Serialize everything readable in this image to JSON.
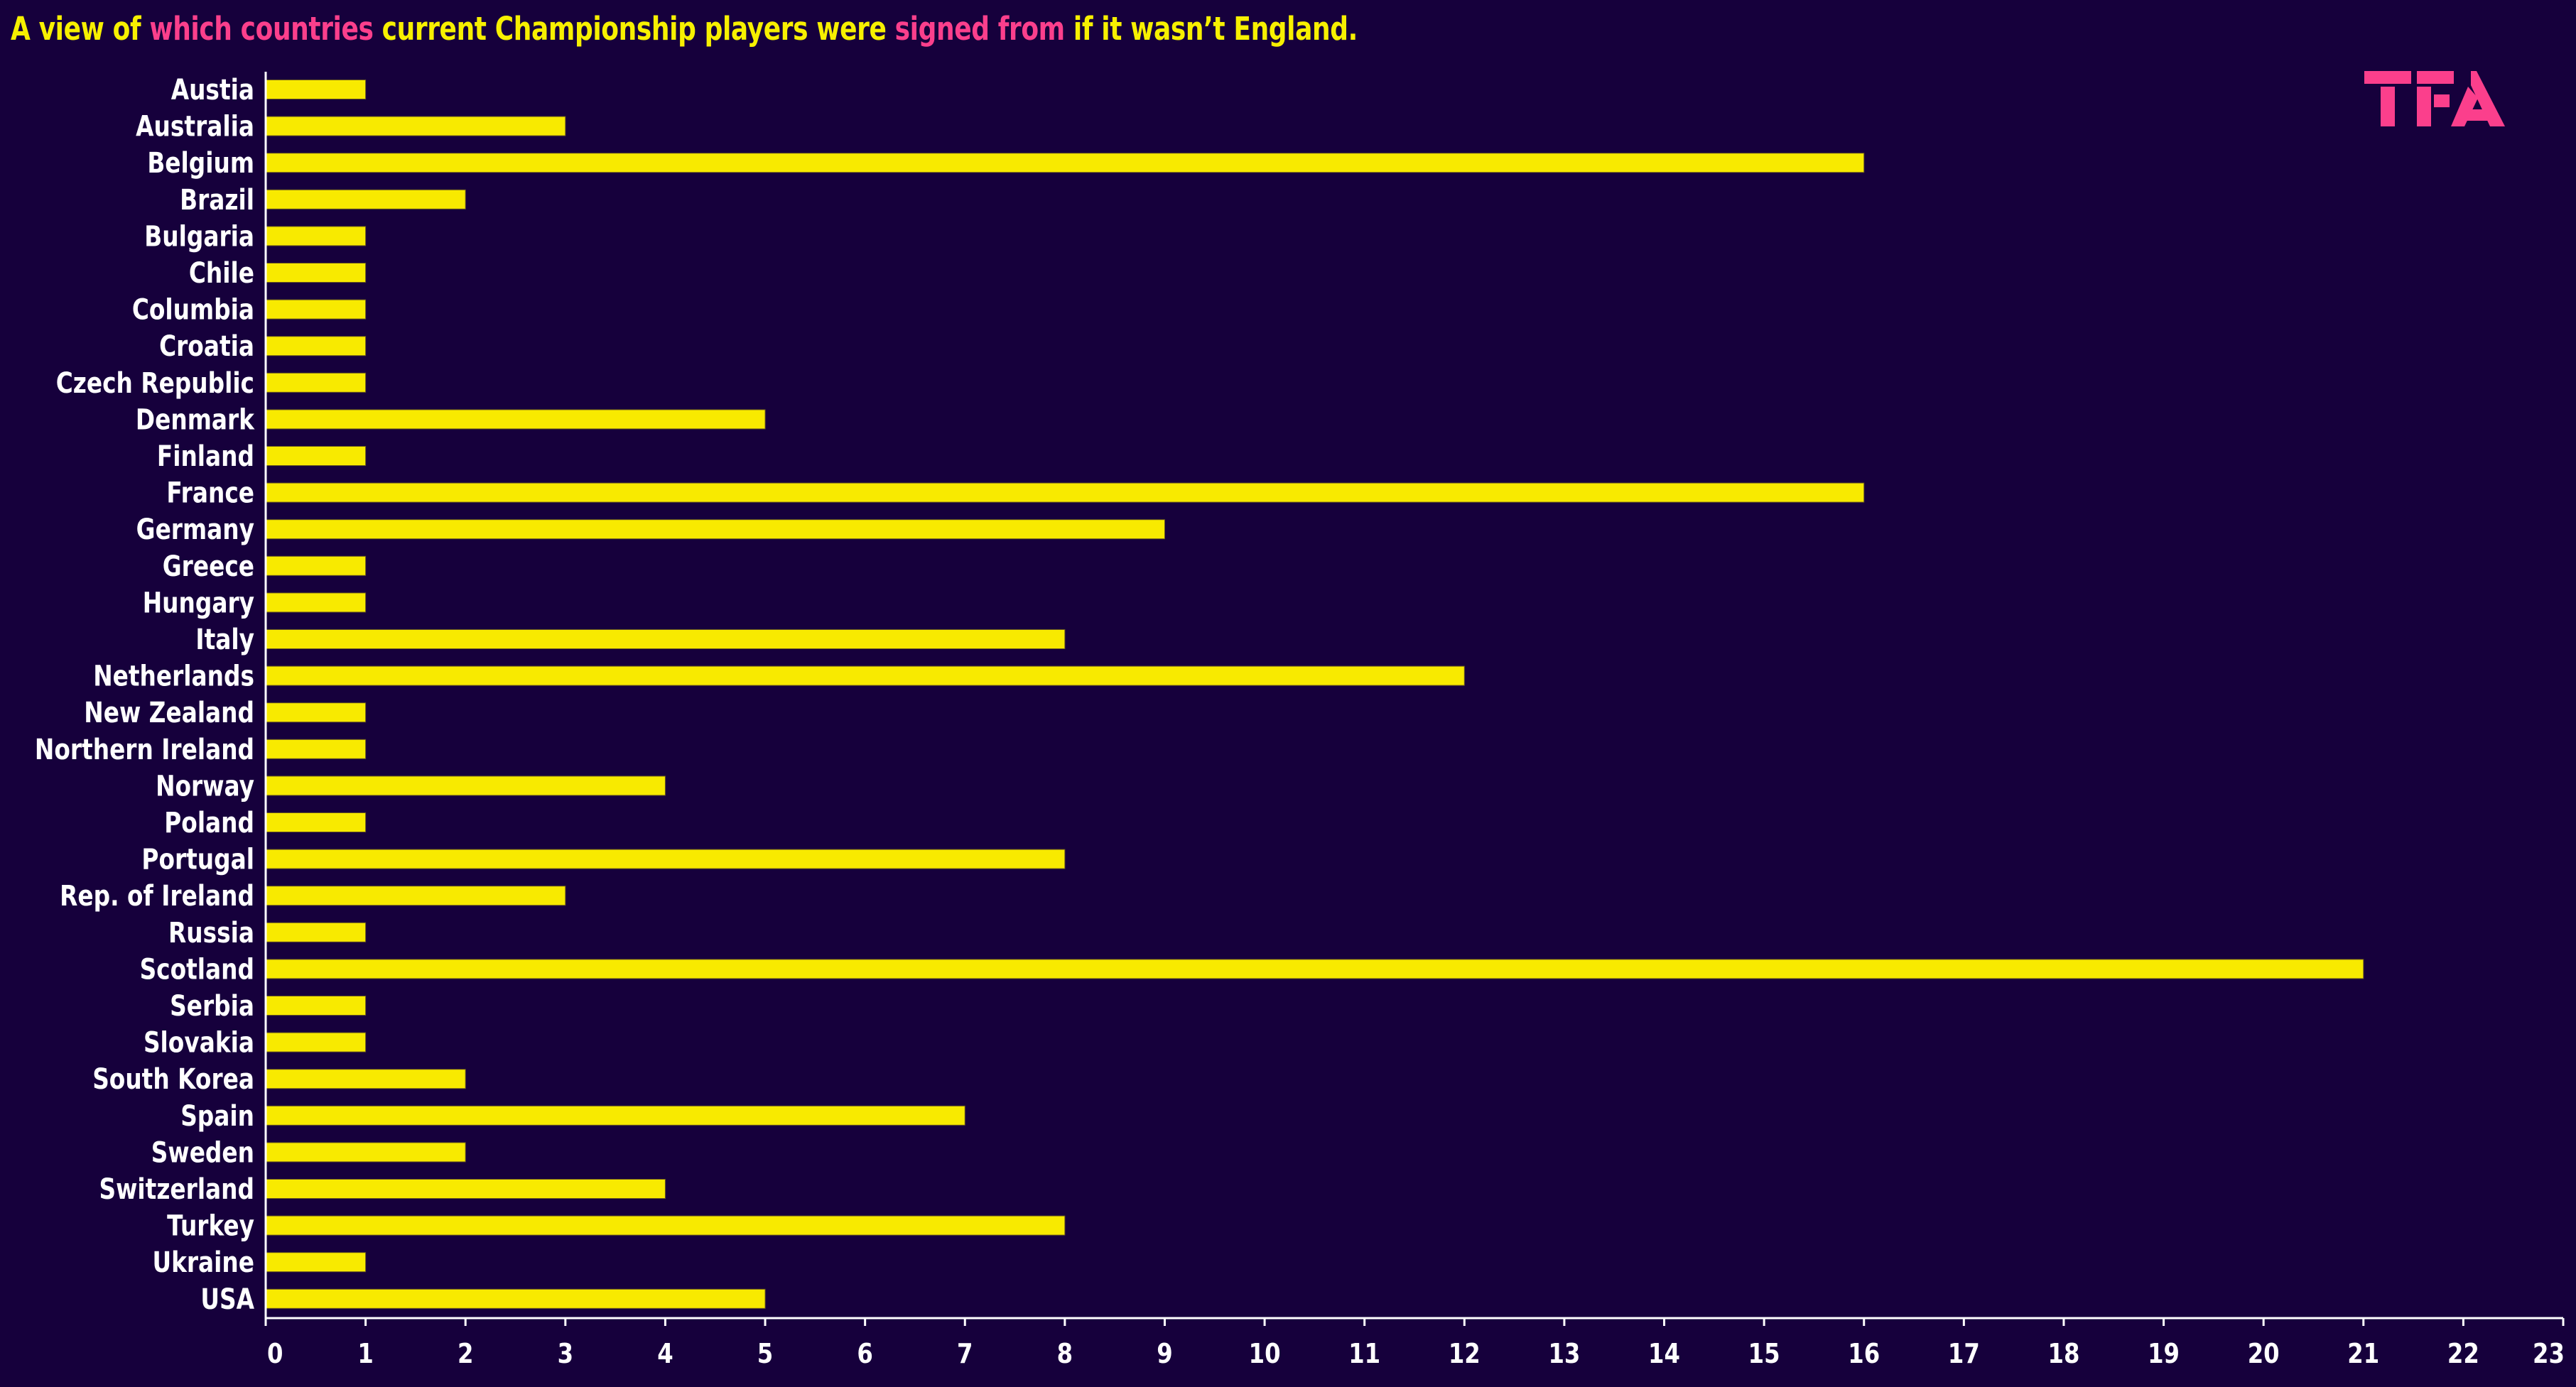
{
  "title": {
    "segments": [
      {
        "text": "A view of ",
        "color": "yellow"
      },
      {
        "text": "which countries",
        "color": "pink"
      },
      {
        "text": " current Championship players were ",
        "color": "yellow"
      },
      {
        "text": "signed from",
        "color": "pink"
      },
      {
        "text": " if it wasn’t England.",
        "color": "yellow"
      }
    ]
  },
  "logo": {
    "text": "TFA",
    "icon": "tfa-logo-icon"
  },
  "colors": {
    "background": "#16003c",
    "bar": "#f8ea00",
    "title_yellow": "#f7f000",
    "title_pink": "#fb3f8c",
    "text": "#ffffff",
    "axis": "#ffffff"
  },
  "chart_data": {
    "type": "bar",
    "orientation": "horizontal",
    "title": "A view of which countries current Championship players were signed from if it wasn’t England.",
    "xlabel": "",
    "ylabel": "",
    "xlim": [
      0,
      23
    ],
    "xticks": [
      0,
      1,
      2,
      3,
      4,
      5,
      6,
      7,
      8,
      9,
      10,
      11,
      12,
      13,
      14,
      15,
      16,
      17,
      18,
      19,
      20,
      21,
      22,
      23
    ],
    "grid": false,
    "legend": "none",
    "categories": [
      "Austia",
      "Australia",
      "Belgium",
      "Brazil",
      "Bulgaria",
      "Chile",
      "Columbia",
      "Croatia",
      "Czech Republic",
      "Denmark",
      "Finland",
      "France",
      "Germany",
      "Greece",
      "Hungary",
      "Italy",
      "Netherlands",
      "New Zealand",
      "Northern Ireland",
      "Norway",
      "Poland",
      "Portugal",
      "Rep. of Ireland",
      "Russia",
      "Scotland",
      "Serbia",
      "Slovakia",
      "South Korea",
      "Spain",
      "Sweden",
      "Switzerland",
      "Turkey",
      "Ukraine",
      "USA"
    ],
    "values": [
      1,
      3,
      16,
      2,
      1,
      1,
      1,
      1,
      1,
      5,
      1,
      16,
      9,
      1,
      1,
      8,
      12,
      1,
      1,
      4,
      1,
      8,
      3,
      1,
      21,
      1,
      1,
      2,
      7,
      2,
      4,
      8,
      1,
      5
    ]
  }
}
